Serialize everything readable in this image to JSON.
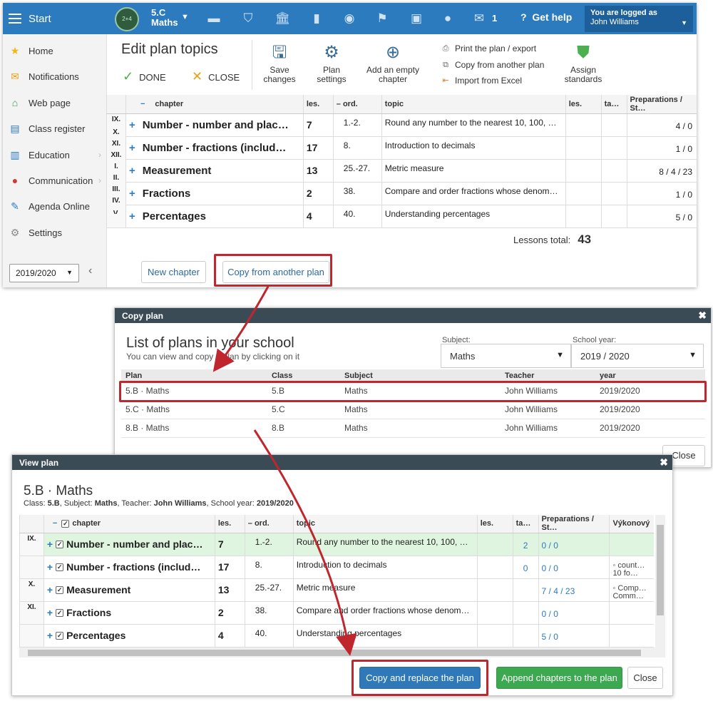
{
  "topbar": {
    "start_label": "Start",
    "class_name": "5.C",
    "class_subject": "Maths",
    "messages_count": "1",
    "help_label": "Get help",
    "logged_label": "You are logged as",
    "logged_user": "John Williams"
  },
  "sidebar": {
    "items": [
      {
        "label": "Home",
        "icon": "star-icon"
      },
      {
        "label": "Notifications",
        "icon": "envelope-icon"
      },
      {
        "label": "Web page",
        "icon": "house-icon"
      },
      {
        "label": "Class register",
        "icon": "notebook-icon"
      },
      {
        "label": "Education",
        "icon": "book-icon"
      },
      {
        "label": "Communication",
        "icon": "chat-icon"
      },
      {
        "label": "Agenda Online",
        "icon": "pen-icon"
      },
      {
        "label": "Settings",
        "icon": "gear-icon"
      }
    ],
    "school_year": "2019/2020"
  },
  "toolbar": {
    "title": "Edit plan topics",
    "done_label": "DONE",
    "close_label": "CLOSE",
    "save_label_1": "Save",
    "save_label_2": "changes",
    "plan_settings_1": "Plan",
    "plan_settings_2": "settings",
    "add_empty_1": "Add an empty",
    "add_empty_2": "chapter",
    "print_label": "Print the plan / export",
    "copy_label": "Copy from another plan",
    "import_label": "Import from Excel",
    "assign_1": "Assign",
    "assign_2": "standards"
  },
  "plan_table": {
    "headers": {
      "collapse": "−",
      "chapter": "chapter",
      "les": "les.",
      "ord": "– ord.",
      "topic": "topic",
      "les2": "les.",
      "ta": "ta…",
      "prep": "Preparations / St…"
    },
    "months": [
      "IX.",
      "X.",
      "XI.",
      "XII.",
      "I.",
      "II.",
      "III.",
      "IV.",
      "V."
    ],
    "rows": [
      {
        "chapter": "Number - number and plac…",
        "les": "7",
        "ord": "1.-2.",
        "topic": "Round any number to the nearest 10, 100, …",
        "prep": "4 / 0"
      },
      {
        "chapter": "Number - fractions (includ…",
        "les": "17",
        "ord": "8.",
        "topic": "Introduction to decimals",
        "prep": "1 / 0"
      },
      {
        "chapter": "Measurement",
        "les": "13",
        "ord": "25.-27.",
        "topic": "Metric measure",
        "prep": "8 / 4 / 23"
      },
      {
        "chapter": "Fractions",
        "les": "2",
        "ord": "38.",
        "topic": "Compare and order fractions whose denom…",
        "prep": "1 / 0"
      },
      {
        "chapter": "Percentages",
        "les": "4",
        "ord": "40.",
        "topic": "Understanding percentages",
        "prep": "5 / 0"
      }
    ],
    "lessons_total_label": "Lessons total:",
    "lessons_total_value": "43",
    "new_chapter_label": "New chapter",
    "copy_plan_label": "Copy from another plan"
  },
  "copy_dialog": {
    "title": "Copy plan",
    "list_title": "List of plans in your school",
    "list_subtitle": "You can view and copy a plan by clicking on it",
    "subject_label": "Subject:",
    "subject_value": "Maths",
    "year_label": "School year:",
    "year_value": "2019 / 2020",
    "headers": [
      "Plan",
      "Class",
      "Subject",
      "Teacher",
      "year"
    ],
    "rows": [
      [
        "5.B · Maths",
        "5.B",
        "Maths",
        "John Williams",
        "2019/2020"
      ],
      [
        "5.C · Maths",
        "5.C",
        "Maths",
        "John Williams",
        "2019/2020"
      ],
      [
        "8.B · Maths",
        "8.B",
        "Maths",
        "John Williams",
        "2019/2020"
      ]
    ],
    "close_label": "Close"
  },
  "view_dialog": {
    "title": "View plan",
    "plan_name": "5.B · Maths",
    "meta": {
      "class_label": "Class:",
      "class": "5.B",
      "subject_label": "Subject:",
      "subject": "Maths",
      "teacher_label": "Teacher:",
      "teacher": "John Williams",
      "year_label": "School year:",
      "year": "2019/2020"
    },
    "headers": {
      "collapse": "−",
      "chapter": "chapter",
      "les": "les.",
      "ord": "– ord.",
      "topic": "topic",
      "les2": "les.",
      "ta": "ta…",
      "prep": "Preparations / St…",
      "vyk": "Výkonový"
    },
    "rows": [
      {
        "month": "IX.",
        "chapter": "Number - number and plac…",
        "les": "7",
        "ord": "1.-2.",
        "topic": "Round any number to the nearest 10, 100, …",
        "ta": "2",
        "prep": "0 / 0",
        "vyk": ""
      },
      {
        "month": "",
        "chapter": "Number - fractions (includ…",
        "les": "17",
        "ord": "8.",
        "topic": "Introduction to decimals",
        "ta": "0",
        "prep": "0 / 0",
        "vyk": "count… 10 fo…"
      },
      {
        "month": "X.",
        "chapter": "Measurement",
        "les": "13",
        "ord": "25.-27.",
        "topic": "Metric measure",
        "ta": "",
        "prep": "7 / 4 / 23",
        "vyk": "Comp… Comm…"
      },
      {
        "month": "XI.",
        "chapter": "Fractions",
        "les": "2",
        "ord": "38.",
        "topic": "Compare and order fractions whose denom…",
        "ta": "",
        "prep": "0 / 0",
        "vyk": ""
      },
      {
        "month": "",
        "chapter": "Percentages",
        "les": "4",
        "ord": "40.",
        "topic": "Understanding percentages",
        "ta": "",
        "prep": "5 / 0",
        "vyk": ""
      }
    ],
    "copy_replace_label": "Copy and replace the plan",
    "append_label": "Append chapters to the plan",
    "close_label": "Close"
  },
  "colors": {
    "topbar": "#2c7bbf",
    "highlight": "#c0262d",
    "primary": "#2f79b8",
    "success": "#3ca850",
    "dialog_header": "#3b4b56"
  }
}
